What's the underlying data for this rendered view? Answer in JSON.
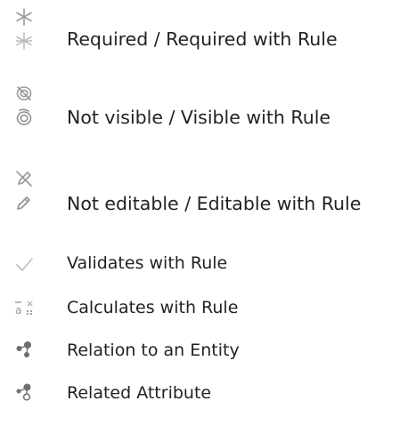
{
  "legend": {
    "items": [
      {
        "label": "Required / Required with Rule",
        "icons": [
          "asterisk-icon",
          "asterisk-rule-icon"
        ]
      },
      {
        "label": "Not visible / Visible with Rule",
        "icons": [
          "eye-hidden-icon",
          "eye-rule-icon"
        ]
      },
      {
        "label": "Not editable / Editable with Rule",
        "icons": [
          "pencil-disabled-icon",
          "pencil-rule-icon"
        ]
      },
      {
        "label": "Validates with Rule",
        "icons": [
          "checkmark-icon"
        ]
      },
      {
        "label": "Calculates with Rule",
        "icons": [
          "calculate-icon"
        ]
      },
      {
        "label": "Relation to an Entity",
        "icons": [
          "relation-icon"
        ]
      },
      {
        "label": "Related Attribute",
        "icons": [
          "related-attribute-icon"
        ]
      }
    ]
  },
  "colors": {
    "text": "#222222",
    "icon_gray": "#9a9a9a",
    "icon_light": "#bdbdbd",
    "icon_dark": "#6f6f6f"
  }
}
